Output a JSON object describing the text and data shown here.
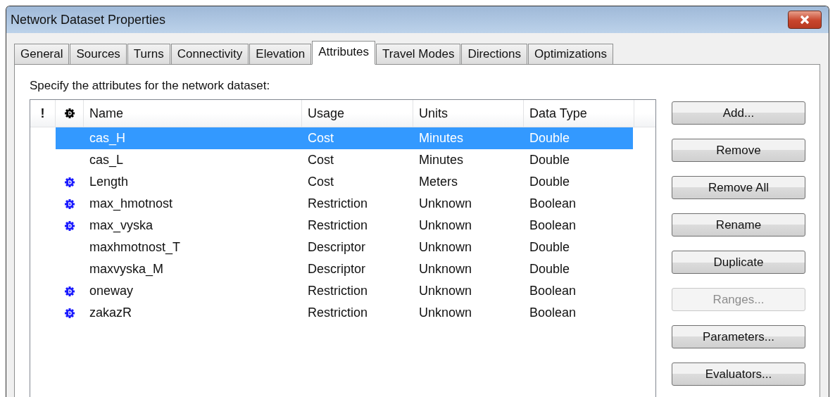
{
  "window": {
    "title": "Network Dataset Properties"
  },
  "tabs": [
    {
      "label": "General",
      "selected": false
    },
    {
      "label": "Sources",
      "selected": false
    },
    {
      "label": "Turns",
      "selected": false
    },
    {
      "label": "Connectivity",
      "selected": false
    },
    {
      "label": "Elevation",
      "selected": false
    },
    {
      "label": "Attributes",
      "selected": true
    },
    {
      "label": "Travel Modes",
      "selected": false
    },
    {
      "label": "Directions",
      "selected": false
    },
    {
      "label": "Optimizations",
      "selected": false
    }
  ],
  "instruction": "Specify the attributes for the network dataset:",
  "table": {
    "columns": [
      "!",
      "Name",
      "Usage",
      "Units",
      "Data Type"
    ],
    "rows": [
      {
        "default": false,
        "selected": true,
        "name": "cas_H",
        "usage": "Cost",
        "units": "Minutes",
        "data_type": "Double"
      },
      {
        "default": false,
        "selected": false,
        "name": "cas_L",
        "usage": "Cost",
        "units": "Minutes",
        "data_type": "Double"
      },
      {
        "default": true,
        "selected": false,
        "name": "Length",
        "usage": "Cost",
        "units": "Meters",
        "data_type": "Double"
      },
      {
        "default": true,
        "selected": false,
        "name": "max_hmotnost",
        "usage": "Restriction",
        "units": "Unknown",
        "data_type": "Boolean"
      },
      {
        "default": true,
        "selected": false,
        "name": "max_vyska",
        "usage": "Restriction",
        "units": "Unknown",
        "data_type": "Boolean"
      },
      {
        "default": false,
        "selected": false,
        "name": "maxhmotnost_T",
        "usage": "Descriptor",
        "units": "Unknown",
        "data_type": "Double"
      },
      {
        "default": false,
        "selected": false,
        "name": "maxvyska_M",
        "usage": "Descriptor",
        "units": "Unknown",
        "data_type": "Double"
      },
      {
        "default": true,
        "selected": false,
        "name": "oneway",
        "usage": "Restriction",
        "units": "Unknown",
        "data_type": "Boolean"
      },
      {
        "default": true,
        "selected": false,
        "name": "zakazR",
        "usage": "Restriction",
        "units": "Unknown",
        "data_type": "Boolean"
      }
    ]
  },
  "buttons": [
    {
      "label": "Add...",
      "disabled": false
    },
    {
      "label": "Remove",
      "disabled": false
    },
    {
      "label": "Remove All",
      "disabled": false
    },
    {
      "label": "Rename",
      "disabled": false
    },
    {
      "label": "Duplicate",
      "disabled": false
    },
    {
      "label": "Ranges...",
      "disabled": true
    },
    {
      "label": "Parameters...",
      "disabled": false
    },
    {
      "label": "Evaluators...",
      "disabled": false
    }
  ]
}
